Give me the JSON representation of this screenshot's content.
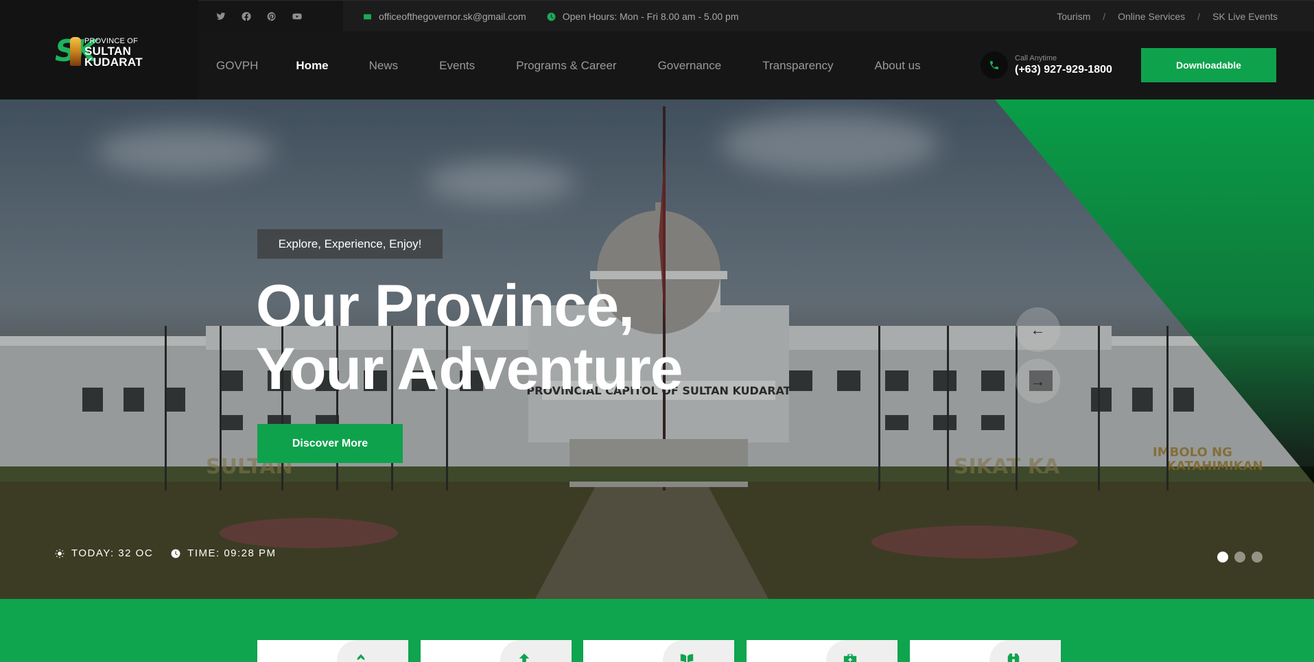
{
  "brand": {
    "logo_mark": "SK",
    "line1": "PROVINCE OF",
    "line2": "SULTAN",
    "line3": "KUDARAT"
  },
  "topbar": {
    "social": [
      "twitter-icon",
      "facebook-icon",
      "pinterest-icon",
      "youtube-icon"
    ],
    "email": "officeofthegovernor.sk@gmail.com",
    "hours": "Open Hours: Mon - Fri 8.00 am - 5.00 pm",
    "links": [
      "Tourism",
      "Online Services",
      "SK Live Events"
    ],
    "separator": "/"
  },
  "nav": {
    "items": [
      "GOVPH",
      "Home",
      "News",
      "Events",
      "Programs & Career",
      "Governance",
      "Transparency",
      "About us"
    ],
    "active": "Home"
  },
  "call": {
    "label": "Call Anytime",
    "number": "(+63) 927-929-1800"
  },
  "header_button": "Downloadable",
  "hero": {
    "tagline": "Explore, Experience, Enjoy!",
    "title_line1": "Our Province,",
    "title_line2": "Your Adventure",
    "cta": "Discover More",
    "prev_arrow": "←",
    "next_arrow": "→",
    "weather": "TODAY: 32 OC",
    "time": "TIME: 09:28 PM",
    "slides_total": 3,
    "slide_active": 1
  },
  "colors": {
    "accent": "#0fa44e",
    "header_bg": "#161616"
  }
}
